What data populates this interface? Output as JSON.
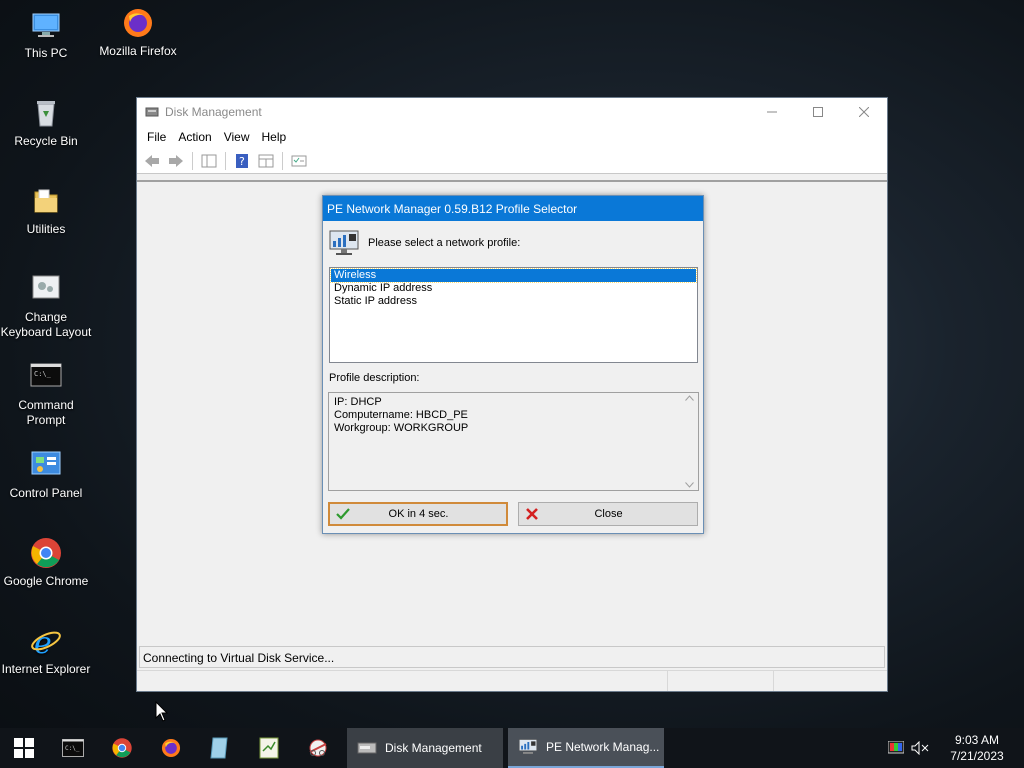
{
  "desktop": {
    "icons": [
      {
        "label": "This PC",
        "icon": "computer-icon"
      },
      {
        "label": "Mozilla Firefox",
        "icon": "firefox-icon"
      },
      {
        "label": "Recycle Bin",
        "icon": "recycle-bin-icon"
      },
      {
        "label": "Utilities",
        "icon": "folder-icon"
      },
      {
        "label": "Change Keyboard Layout",
        "icon": "keyboard-settings-icon"
      },
      {
        "label": "Command Prompt",
        "icon": "terminal-icon"
      },
      {
        "label": "Control Panel",
        "icon": "control-panel-icon"
      },
      {
        "label": "Google Chrome",
        "icon": "chrome-icon"
      },
      {
        "label": "Internet Explorer",
        "icon": "internet-explorer-icon"
      }
    ]
  },
  "disk_management": {
    "title": "Disk Management",
    "menu": [
      "File",
      "Action",
      "View",
      "Help"
    ],
    "status_text": "Connecting to Virtual Disk Service..."
  },
  "dialog": {
    "title": "PE Network Manager 0.59.B12 Profile Selector",
    "prompt": "Please select a network profile:",
    "profiles": [
      "Wireless",
      "Dynamic IP address",
      "Static IP address"
    ],
    "selected_profile": "Wireless",
    "description_label": "Profile description:",
    "description_lines": [
      "IP: DHCP",
      "Computername: HBCD_PE",
      "Workgroup: WORKGROUP"
    ],
    "ok_label": "OK in 4 sec.",
    "close_label": "Close"
  },
  "taskbar": {
    "tasks": [
      {
        "label": "Disk Management",
        "icon": "disk-management-icon"
      },
      {
        "label": "PE Network Manag...",
        "icon": "network-manager-icon"
      }
    ],
    "time": "9:03 AM",
    "date": "7/21/2023"
  },
  "colors": {
    "accent": "#0a78d7",
    "taskbar": "#101419",
    "ok_border": "#d08a3a"
  }
}
